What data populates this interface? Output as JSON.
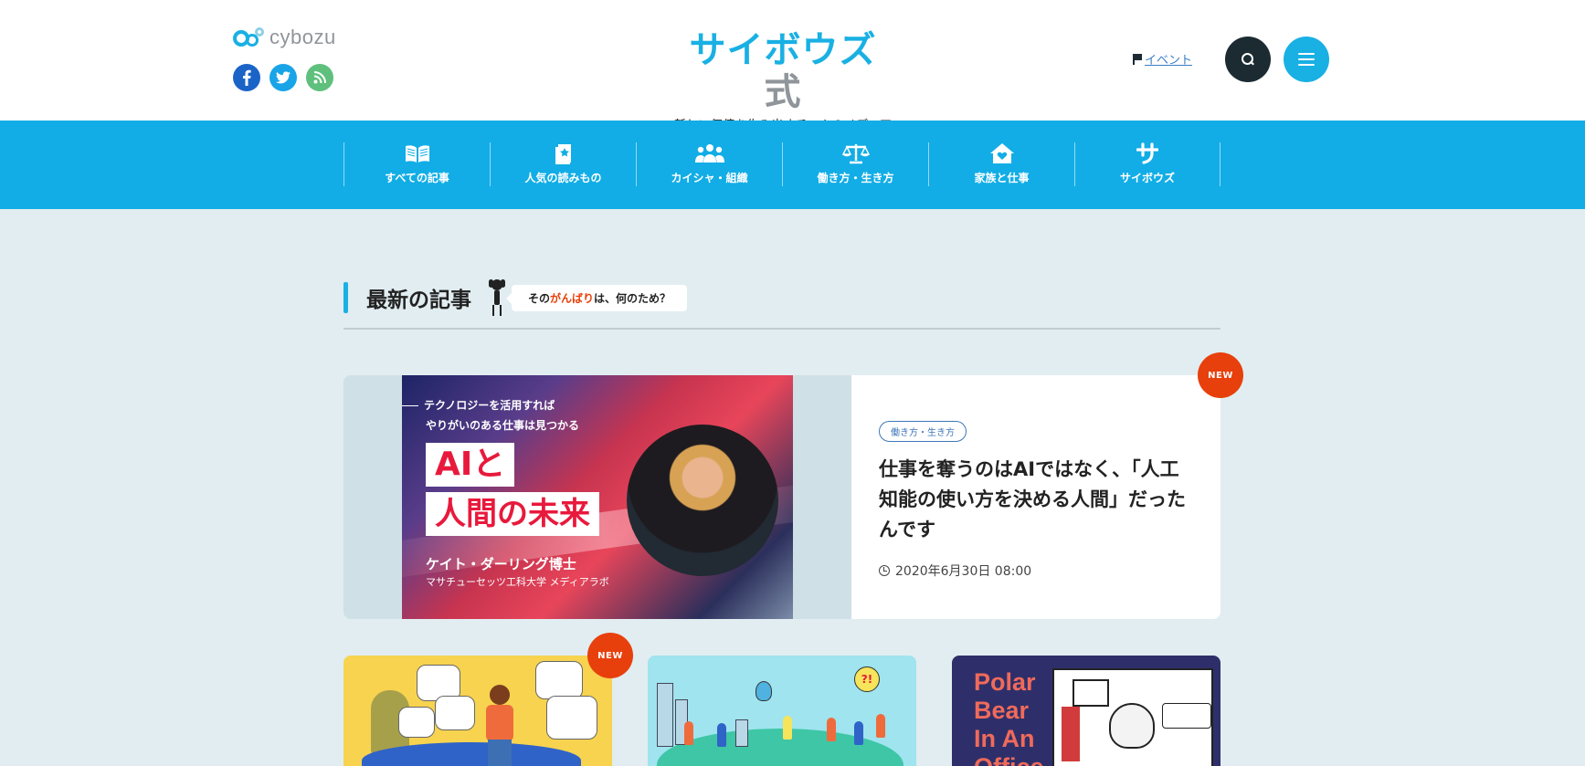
{
  "header": {
    "brand_word": "cybozu",
    "social": [
      {
        "name": "facebook-icon",
        "glyph": "f"
      },
      {
        "name": "twitter-icon",
        "glyph": "t"
      },
      {
        "name": "rss-icon",
        "glyph": "r"
      }
    ],
    "logo_title_main": "サイボウズ",
    "logo_title_suffix": "式",
    "logo_tagline": "新しい価値を生み出すチームのメディア",
    "event_label": "イベント",
    "search_icon": "search-icon",
    "menu_icon": "hamburger-menu-icon"
  },
  "nav": {
    "items": [
      {
        "label": "すべての記事",
        "icon": "open-book-icon"
      },
      {
        "label": "人気の読みもの",
        "icon": "star-book-icon"
      },
      {
        "label": "カイシャ・組織",
        "icon": "people-group-icon"
      },
      {
        "label": "働き方・生き方",
        "icon": "balance-scale-icon"
      },
      {
        "label": "家族と仕事",
        "icon": "heart-house-icon"
      },
      {
        "label": "サイボウズ",
        "icon": "cybozu-sa-icon"
      }
    ]
  },
  "section": {
    "title": "最新の記事",
    "bubble_pre": "その",
    "bubble_accent": "がんばり",
    "bubble_post": "は、何のため？"
  },
  "featured": {
    "image_kicker_1": "テクノロジーを活用すれば",
    "image_kicker_2": "やりがいのある仕事は見つかる",
    "image_title_1": "AIと",
    "image_title_2": "人間の未来",
    "image_person": "ケイト・ダーリング博士",
    "image_affiliation": "マサチューセッツ工科大学 メディアラボ",
    "category": "働き方・生き方",
    "headline": "仕事を奪うのはAIではなく、「人工知能の使い方を決める人間」だったんです",
    "date": "2020年6月30日 08:00",
    "badge": "NEW"
  },
  "cards": [
    {
      "badge": "NEW"
    },
    {
      "speech": "?!"
    },
    {
      "title_lines": [
        "Polar",
        "Bear",
        "In An",
        "Office"
      ]
    }
  ],
  "colors": {
    "brand_blue": "#12ade6",
    "dark": "#1c2a32",
    "new_badge": "#e8400c",
    "background": "#e1edf1"
  }
}
